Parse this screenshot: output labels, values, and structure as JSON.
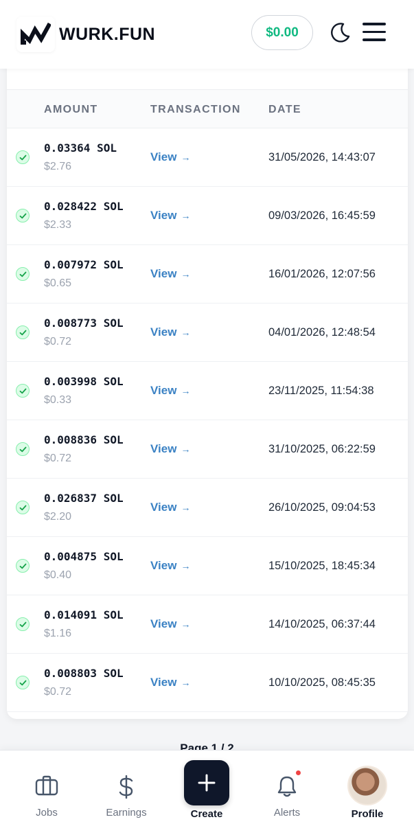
{
  "header": {
    "brand": "WURK.FUN",
    "balance": "$0.00"
  },
  "table": {
    "columns": [
      "AMOUNT",
      "TRANSACTION",
      "DATE"
    ],
    "rows": [
      {
        "amount": "0.03364 SOL",
        "usd": "$2.76",
        "link": "View",
        "date": "31/05/2026, 14:43:07"
      },
      {
        "amount": "0.028422 SOL",
        "usd": "$2.33",
        "link": "View",
        "date": "09/03/2026, 16:45:59"
      },
      {
        "amount": "0.007972 SOL",
        "usd": "$0.65",
        "link": "View",
        "date": "16/01/2026, 12:07:56"
      },
      {
        "amount": "0.008773 SOL",
        "usd": "$0.72",
        "link": "View",
        "date": "04/01/2026, 12:48:54"
      },
      {
        "amount": "0.003998 SOL",
        "usd": "$0.33",
        "link": "View",
        "date": "23/11/2025, 11:54:38"
      },
      {
        "amount": "0.008836 SOL",
        "usd": "$0.72",
        "link": "View",
        "date": "31/10/2025, 06:22:59"
      },
      {
        "amount": "0.026837 SOL",
        "usd": "$2.20",
        "link": "View",
        "date": "26/10/2025, 09:04:53"
      },
      {
        "amount": "0.004875 SOL",
        "usd": "$0.40",
        "link": "View",
        "date": "15/10/2025, 18:45:34"
      },
      {
        "amount": "0.014091 SOL",
        "usd": "$1.16",
        "link": "View",
        "date": "14/10/2025, 06:37:44"
      },
      {
        "amount": "0.008803 SOL",
        "usd": "$0.72",
        "link": "View",
        "date": "10/10/2025, 08:45:35"
      }
    ],
    "link_arrow": "→"
  },
  "pagination": {
    "label": "Page 1 / 2"
  },
  "bottom_nav": {
    "items": [
      {
        "label": "Jobs",
        "icon": "briefcase-icon"
      },
      {
        "label": "Earnings",
        "icon": "dollar-icon"
      },
      {
        "label": "Create",
        "icon": "plus-icon"
      },
      {
        "label": "Alerts",
        "icon": "bell-icon"
      },
      {
        "label": "Profile",
        "icon": "avatar"
      }
    ]
  },
  "colors": {
    "accent_green": "#10b981",
    "link_blue": "#3b82c4",
    "dark": "#0f172a",
    "alert_red": "#ef4444"
  }
}
